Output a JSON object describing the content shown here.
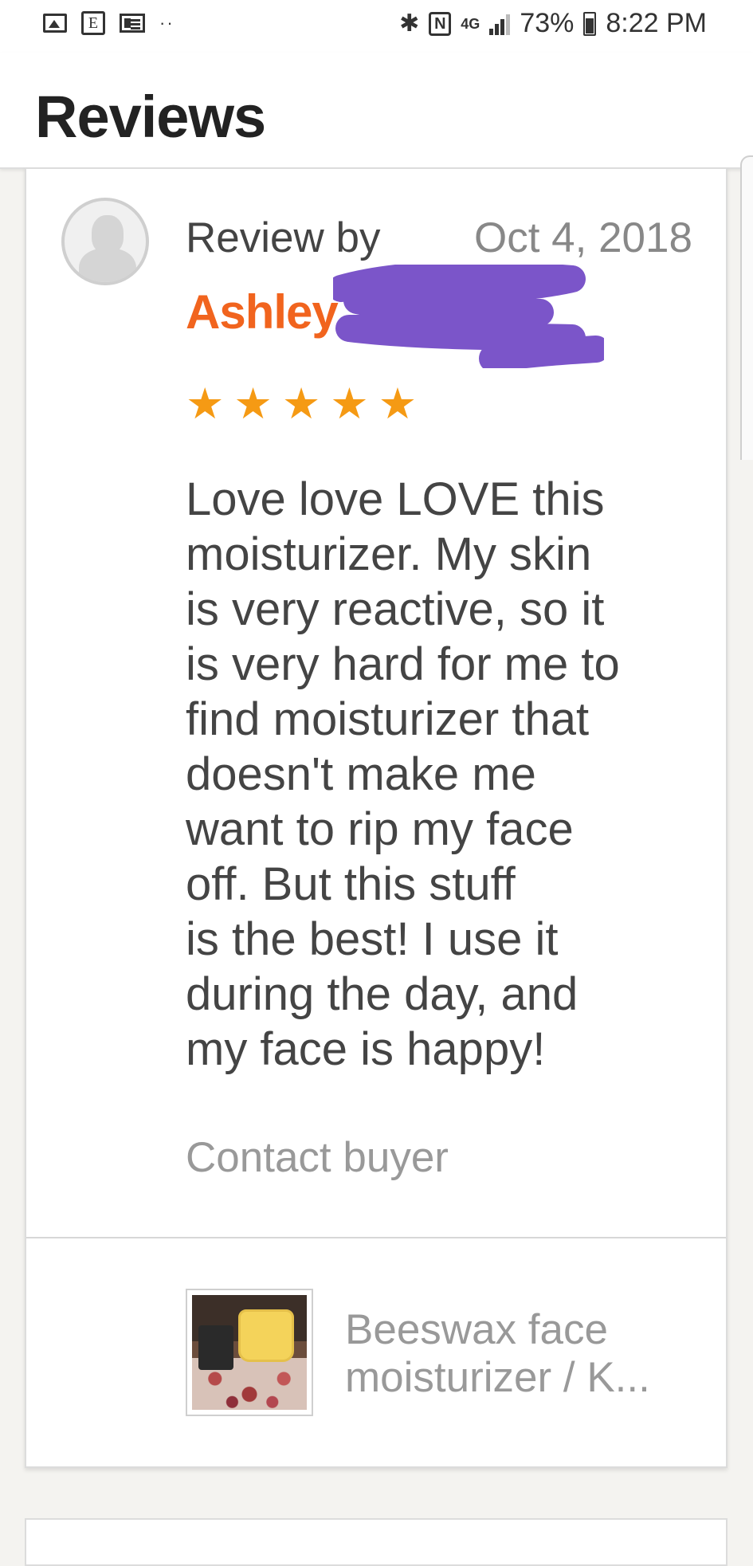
{
  "status_bar": {
    "icons_left": [
      "gallery-icon",
      "etsy-icon",
      "news-icon",
      "more-dots-icon"
    ],
    "etsy_glyph": "E",
    "dots": "··",
    "bluetooth_glyph": "✱",
    "nfc_glyph": "N",
    "network": "4G",
    "battery_percent": "73%",
    "time": "8:22 PM"
  },
  "header": {
    "title": "Reviews"
  },
  "review": {
    "review_by_label": "Review by",
    "date": "Oct 4, 2018",
    "reviewer_name": "Ashley",
    "rating": 5,
    "star_glyph": "★",
    "text": "Love love LOVE this\nmoisturizer.  My skin\nis very reactive, so it\nis very hard for me to\nfind moisturizer that\ndoesn't make me\nwant to rip my face\noff.  But this stuff\nis the best!  I use it\nduring the day, and\nmy face is happy!",
    "contact_label": "Contact buyer",
    "product_title": "Beeswax face moisturizer / K..."
  },
  "colors": {
    "reviewer_name": "#f1641e",
    "stars": "#f59a14",
    "redaction": "#7b55c9",
    "muted_text": "#999999"
  }
}
